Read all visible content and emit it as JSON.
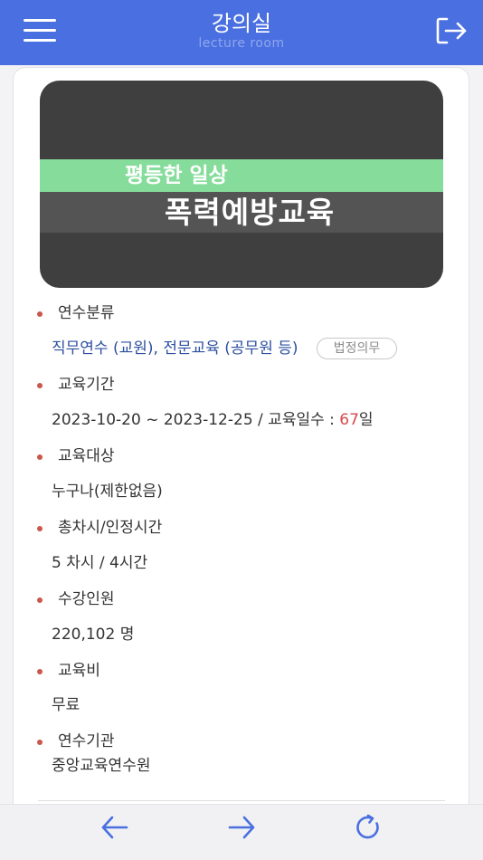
{
  "header": {
    "title": "강의실",
    "subtitle": "lecture room"
  },
  "banner": {
    "subtitle": "평등한 일상",
    "title": "폭력예방교육",
    "colors": {
      "background": "#3f3f3f",
      "stripe": "#86dc9b"
    }
  },
  "details": {
    "category_label": "연수분류",
    "category_value": "직무연수 (교원), 전문교육 (공무원 등)",
    "category_tag": "법정의무",
    "period_label": "교육기간",
    "period_value": "2023-10-20 ~ 2023-12-25 / 교육일수 : ",
    "period_days": "67",
    "period_unit": "일",
    "target_label": "교육대상",
    "target_value": "누구나(제한없음)",
    "sessions_label": "총차시/인정시간",
    "sessions_value": "5 차시 / 4시간",
    "enrollment_label": "수강인원",
    "enrollment_value": "220,102 명",
    "fee_label": "교육비",
    "fee_value": "무료",
    "institution_label": "연수기관",
    "institution_value": "중앙교육연수원"
  },
  "colors": {
    "header": "#4a6fe0",
    "bullet": "#c9574c",
    "link": "#2c4fa0",
    "highlight": "#d64a4a",
    "nav_icon": "#4a6fe0"
  },
  "icons": {
    "menu": "hamburger-menu-icon",
    "logout": "logout-icon",
    "back": "arrow-left-icon",
    "forward": "arrow-right-icon",
    "refresh": "refresh-icon"
  }
}
